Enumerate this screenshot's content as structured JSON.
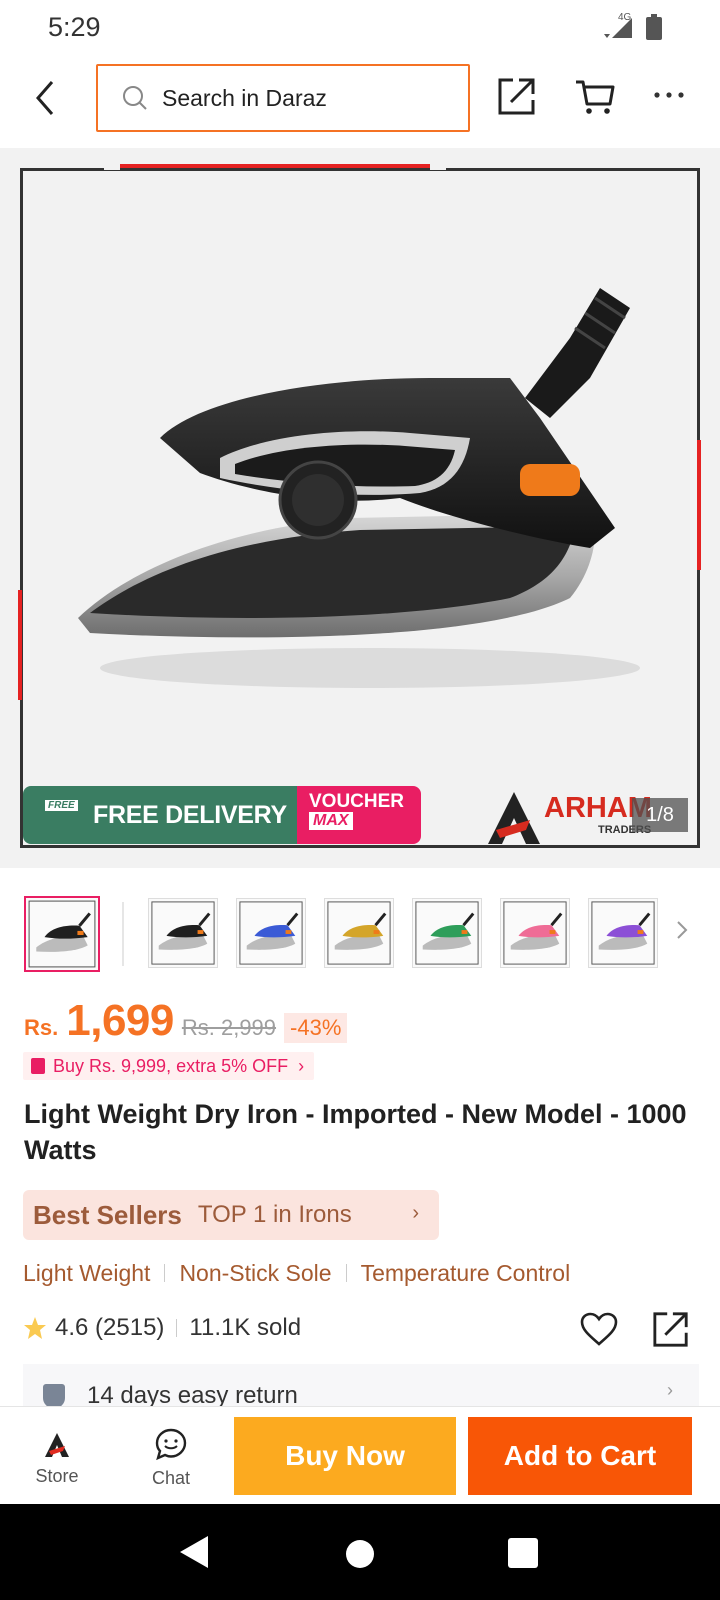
{
  "status_bar": {
    "time": "5:29",
    "network": "4G"
  },
  "header": {
    "search_placeholder": "Search in Daraz"
  },
  "gallery": {
    "promo_free_tag": "FREE",
    "promo_delivery": "FREE DELIVERY",
    "promo_voucher": "VOUCHER",
    "promo_voucher_max": "MAX",
    "brand_name": "ARHAM",
    "brand_sub": "TRADERS",
    "counter": "1/8",
    "thumb_colors": [
      "#1f1f1f",
      "#1f1f1f",
      "#3b5bd6",
      "#d4a52a",
      "#2e9e5a",
      "#ef6c96",
      "#8c4fd6"
    ]
  },
  "price": {
    "currency": "Rs.",
    "current": "1,699",
    "original": "Rs. 2,999",
    "discount": "-43%"
  },
  "promo": {
    "text": "Buy Rs. 9,999, extra 5% OFF"
  },
  "product": {
    "title": "Light Weight Dry Iron - Imported - New Model - 1000 Watts"
  },
  "best_seller": {
    "title": "Best Sellers",
    "rank": "TOP 1 in Irons"
  },
  "features": [
    "Light Weight",
    "Non-Stick Sole",
    "Temperature Control"
  ],
  "rating": {
    "score": "4.6 (2515)",
    "sold": "11.1K sold"
  },
  "return_policy": {
    "text": "14 days easy return"
  },
  "action_bar": {
    "store_label": "Store",
    "chat_label": "Chat",
    "buy_now": "Buy Now",
    "add_to_cart": "Add to Cart"
  },
  "colors": {
    "brand_orange": "#f57224",
    "buy_now": "#fcaa1f",
    "add_cart": "#f85606",
    "pink": "#e91e63"
  }
}
